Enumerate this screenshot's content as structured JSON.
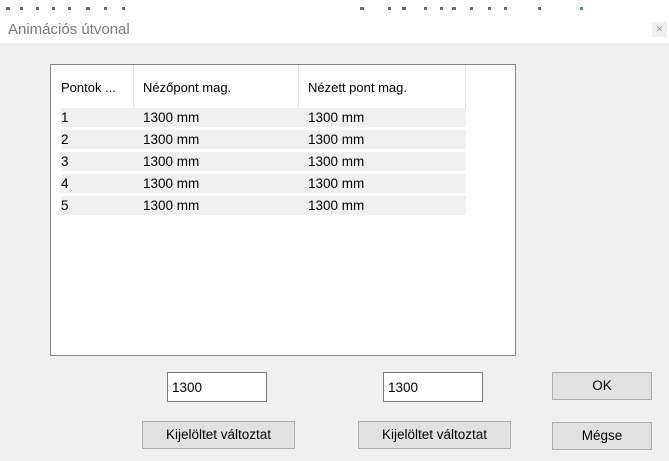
{
  "window": {
    "title": "Animációs útvonal"
  },
  "list": {
    "columns": [
      "Pontok ...",
      "Nézőpont mag.",
      "Nézett pont mag."
    ],
    "rows": [
      [
        "1",
        "1300 mm",
        "1300 mm"
      ],
      [
        "2",
        "1300 mm",
        "1300 mm"
      ],
      [
        "3",
        "1300 mm",
        "1300 mm"
      ],
      [
        "4",
        "1300 mm",
        "1300 mm"
      ],
      [
        "5",
        "1300 mm",
        "1300 mm"
      ]
    ]
  },
  "inputs": {
    "viewpoint_height": "1300",
    "target_height": "1300"
  },
  "buttons": {
    "change_selected_viewpoint": "Kijelöltet változtat",
    "change_selected_target": "Kijelöltet változtat",
    "ok": "OK",
    "cancel": "Mégse"
  }
}
